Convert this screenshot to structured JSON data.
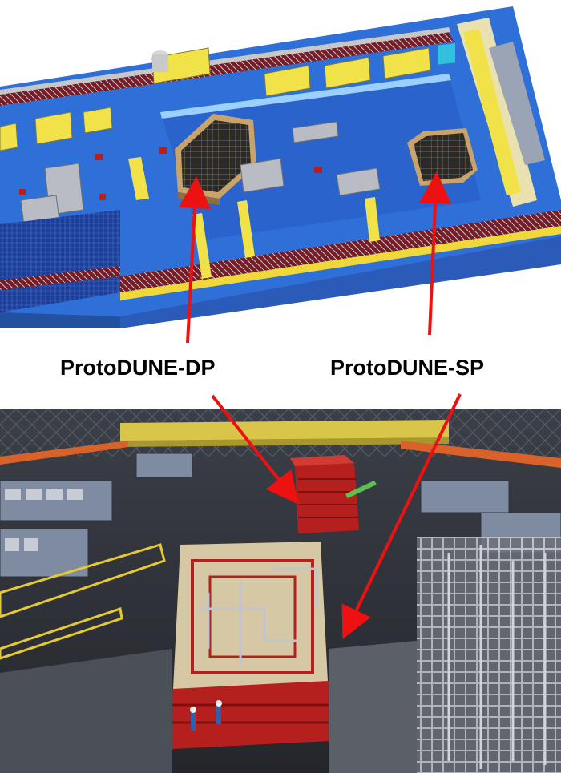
{
  "labels": {
    "dp": "ProtoDUNE-DP",
    "sp": "ProtoDUNE-SP"
  },
  "colors": {
    "arrow": "#ee1111",
    "floor_blue": "#2f6fd8",
    "cad_yellow": "#f2e24a",
    "steel_red": "#b5201e",
    "hall_dark": "#2a2d33"
  },
  "panels": {
    "top": "cad-3d-model-of-neutrino-platform-hall",
    "bottom": "photo-of-protodune-detectors-in-hall"
  }
}
